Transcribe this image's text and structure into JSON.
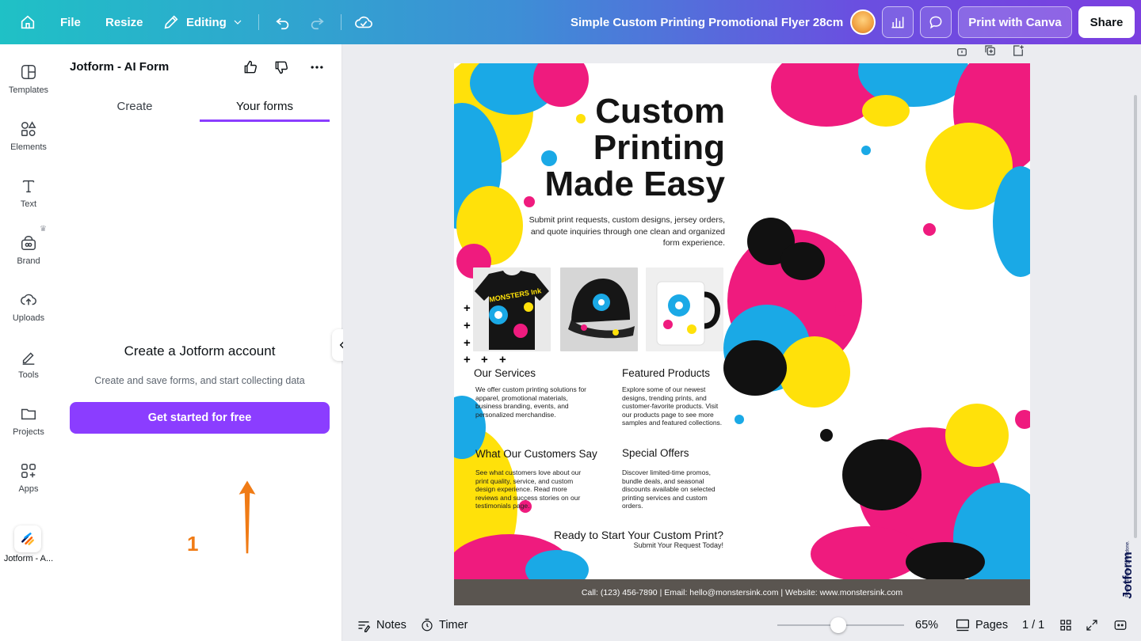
{
  "topbar": {
    "file_label": "File",
    "resize_label": "Resize",
    "editing_label": "Editing",
    "doc_title": "Simple Custom Printing Promotional Flyer 28cm",
    "print_label": "Print with Canva",
    "share_label": "Share"
  },
  "rail": {
    "items": [
      {
        "label": "Templates"
      },
      {
        "label": "Elements"
      },
      {
        "label": "Text"
      },
      {
        "label": "Brand"
      },
      {
        "label": "Uploads"
      },
      {
        "label": "Tools"
      },
      {
        "label": "Projects"
      },
      {
        "label": "Apps"
      }
    ],
    "active_app_label": "Jotform - A..."
  },
  "panel": {
    "title": "Jotform - AI Form",
    "tabs": [
      "Create",
      "Your forms"
    ],
    "active_tab": 1,
    "empty_title": "Create a Jotform account",
    "empty_subtitle": "Create and save forms, and start collecting data",
    "cta_label": "Get started for free",
    "step_number": "1"
  },
  "flyer": {
    "headline_1": "Custom",
    "headline_2": "Printing",
    "headline_3": "Made Easy",
    "subhead": "Submit print requests, custom designs, jersey orders, and quote inquiries through one clean and organized form experience.",
    "services_title": "Our Services",
    "services_body": "We offer custom printing solutions for apparel, promotional materials, business branding, events, and personalized merchandise.",
    "featured_title": "Featured Products",
    "featured_body": "Explore some of our newest designs, trending prints, and customer-favorite products. Visit our products page to see more samples and featured collections.",
    "customers_title": "What Our Customers Say",
    "customers_body": "See what customers love about our print quality, service, and custom design experience. Read more reviews and success stories on our testimonials page.",
    "offers_title": "Special Offers",
    "offers_body": "Discover limited-time promos, bundle deals, and seasonal discounts available on selected printing services and custom orders.",
    "cta_title": "Ready to Start Your Custom Print?",
    "cta_sub": "Submit Your Request Today!",
    "footer": "Call: (123) 456-7890 | Email: hello@monstersink.com | Website: www.monstersink.com",
    "product_brand": "MONSTERS Ink"
  },
  "bottombar": {
    "notes_label": "Notes",
    "timer_label": "Timer",
    "zoom": "65%",
    "zoom_fraction": 0.48,
    "pages_label": "Pages",
    "page_count": "1 / 1"
  },
  "watermark": {
    "brand": "Jotform",
    "tagline": "Powerful forms get it done."
  },
  "colors": {
    "accent": "#8b3dff",
    "arrow": "#f07b15",
    "cyan": "#1aa9e6",
    "magenta": "#ef1b7e",
    "yellow": "#ffe10a"
  }
}
